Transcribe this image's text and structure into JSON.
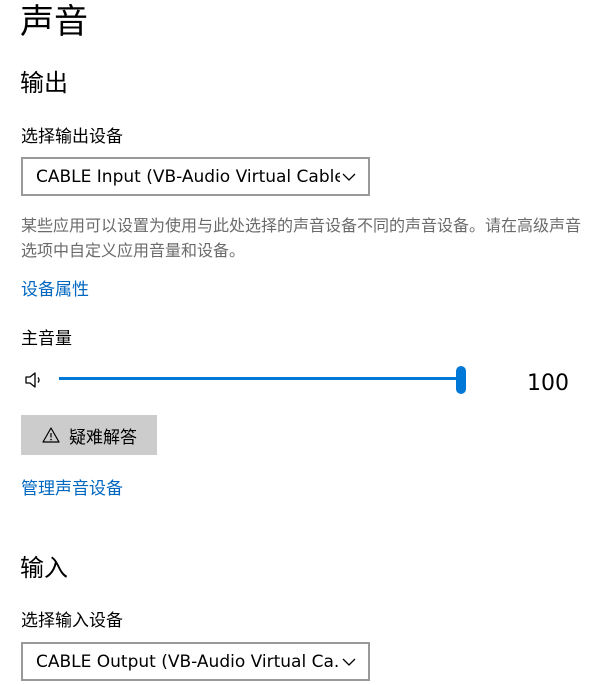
{
  "page": {
    "title": "声音"
  },
  "output": {
    "section_title": "输出",
    "device_label": "选择输出设备",
    "device_selected": "CABLE Input (VB-Audio Virtual Cable)",
    "description": "某些应用可以设置为使用与此处选择的声音设备不同的声音设备。请在高级声音选项中自定义应用音量和设备。",
    "properties_link": "设备属性",
    "volume_label": "主音量",
    "volume_value": "100",
    "volume_level": 1.0,
    "troubleshoot_label": "疑难解答",
    "manage_link": "管理声音设备"
  },
  "input": {
    "section_title": "输入",
    "device_label": "选择输入设备",
    "device_selected": "CABLE Output (VB-Audio Virtual Ca..."
  },
  "icons": {
    "speaker": "speaker-icon",
    "chevron": "chevron-down-icon",
    "warning": "warning-icon"
  },
  "colors": {
    "accent": "#0078d7",
    "link": "#0067c0",
    "button_bg": "#cccccc",
    "description_text": "#6b6b6b"
  }
}
